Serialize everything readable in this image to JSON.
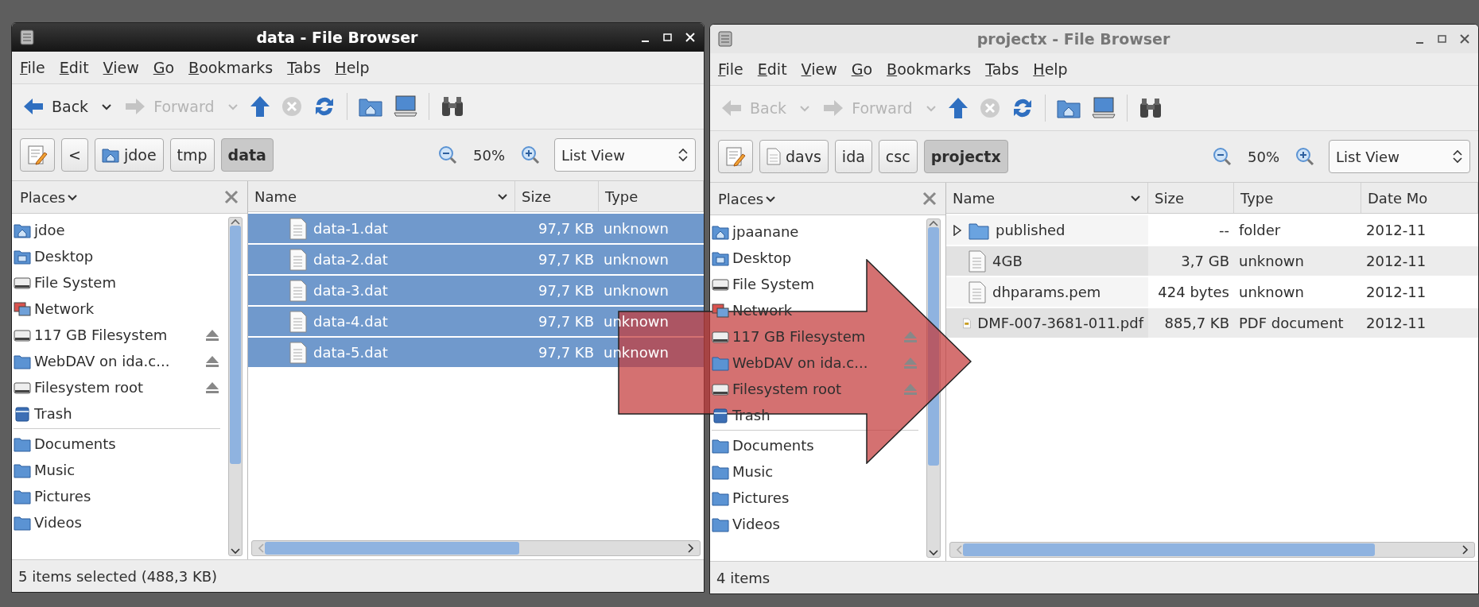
{
  "windows": [
    {
      "title": "data - File Browser",
      "active": true,
      "menu": [
        "File",
        "Edit",
        "View",
        "Go",
        "Bookmarks",
        "Tabs",
        "Help"
      ],
      "back": {
        "label": "Back",
        "disabled": false
      },
      "forward": {
        "label": "Forward",
        "disabled": true
      },
      "path": [
        {
          "label": "<",
          "kind": "scroll",
          "selected": false
        },
        {
          "label": "jdoe",
          "kind": "home",
          "selected": false
        },
        {
          "label": "tmp",
          "kind": "plain",
          "selected": false
        },
        {
          "label": "data",
          "kind": "plain",
          "selected": true
        }
      ],
      "zoom": "50%",
      "view": "List View",
      "places_label": "Places",
      "places": [
        [
          {
            "label": "jdoe",
            "kind": "home",
            "eject": false
          },
          {
            "label": "Desktop",
            "kind": "desktop",
            "eject": false
          },
          {
            "label": "File System",
            "kind": "drive",
            "eject": false
          },
          {
            "label": "Network",
            "kind": "network",
            "eject": false
          },
          {
            "label": "117 GB Filesystem",
            "kind": "drive",
            "eject": true
          },
          {
            "label": "WebDAV on ida.c...",
            "kind": "folder",
            "eject": true
          },
          {
            "label": "Filesystem root",
            "kind": "drive",
            "eject": true
          },
          {
            "label": "Trash",
            "kind": "trash",
            "eject": false
          }
        ],
        [
          {
            "label": "Documents",
            "kind": "folder",
            "eject": false
          },
          {
            "label": "Music",
            "kind": "folder",
            "eject": false
          },
          {
            "label": "Pictures",
            "kind": "folder",
            "eject": false
          },
          {
            "label": "Videos",
            "kind": "folder",
            "eject": false
          }
        ]
      ],
      "columns": [
        "Name",
        "Size",
        "Type"
      ],
      "rows": [
        {
          "kind": "file",
          "cells": [
            "data-1.dat",
            "97,7 KB",
            "unknown"
          ],
          "selected": true
        },
        {
          "kind": "file",
          "cells": [
            "data-2.dat",
            "97,7 KB",
            "unknown"
          ],
          "selected": true
        },
        {
          "kind": "file",
          "cells": [
            "data-3.dat",
            "97,7 KB",
            "unknown"
          ],
          "selected": true
        },
        {
          "kind": "file",
          "cells": [
            "data-4.dat",
            "97,7 KB",
            "unknown"
          ],
          "selected": true
        },
        {
          "kind": "file",
          "cells": [
            "data-5.dat",
            "97,7 KB",
            "unknown"
          ],
          "selected": true
        }
      ],
      "status": "5 items selected (488,3 KB)"
    },
    {
      "title": "projectx - File Browser",
      "active": false,
      "menu": [
        "File",
        "Edit",
        "View",
        "Go",
        "Bookmarks",
        "Tabs",
        "Help"
      ],
      "back": {
        "label": "Back",
        "disabled": true
      },
      "forward": {
        "label": "Forward",
        "disabled": true
      },
      "path": [
        {
          "label": "davs",
          "kind": "drive",
          "selected": false
        },
        {
          "label": "ida",
          "kind": "plain",
          "selected": false
        },
        {
          "label": "csc",
          "kind": "plain",
          "selected": false
        },
        {
          "label": "projectx",
          "kind": "plain",
          "selected": true
        }
      ],
      "zoom": "50%",
      "view": "List View",
      "places_label": "Places",
      "places": [
        [
          {
            "label": "jpaanane",
            "kind": "home",
            "eject": false
          },
          {
            "label": "Desktop",
            "kind": "desktop",
            "eject": false
          },
          {
            "label": "File System",
            "kind": "drive",
            "eject": false
          },
          {
            "label": "Network",
            "kind": "network",
            "eject": false
          },
          {
            "label": "117 GB Filesystem",
            "kind": "drive",
            "eject": true
          },
          {
            "label": "WebDAV on ida.c...",
            "kind": "folder",
            "eject": true
          },
          {
            "label": "Filesystem root",
            "kind": "drive",
            "eject": true
          },
          {
            "label": "Trash",
            "kind": "trash",
            "eject": false
          }
        ],
        [
          {
            "label": "Documents",
            "kind": "folder",
            "eject": false
          },
          {
            "label": "Music",
            "kind": "folder",
            "eject": false
          },
          {
            "label": "Pictures",
            "kind": "folder",
            "eject": false
          },
          {
            "label": "Videos",
            "kind": "folder",
            "eject": false
          }
        ]
      ],
      "columns": [
        "Name",
        "Size",
        "Type",
        "Date Mo"
      ],
      "rows": [
        {
          "kind": "folder",
          "cells": [
            "published",
            "--",
            "folder",
            "2012-11"
          ],
          "selected": false
        },
        {
          "kind": "file",
          "cells": [
            "4GB",
            "3,7 GB",
            "unknown",
            "2012-11"
          ],
          "selected": false
        },
        {
          "kind": "file",
          "cells": [
            "dhparams.pem",
            "424 bytes",
            "unknown",
            "2012-11"
          ],
          "selected": false
        },
        {
          "kind": "pdf",
          "cells": [
            "DMF-007-3681-011.pdf",
            "885,7 KB",
            "PDF document",
            "2012-11"
          ],
          "selected": false
        }
      ],
      "status": "4 items"
    }
  ]
}
